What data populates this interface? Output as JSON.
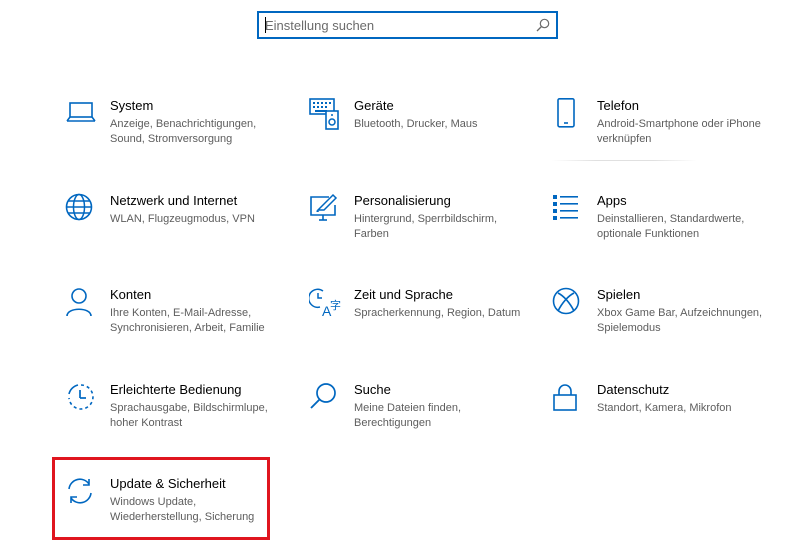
{
  "search": {
    "placeholder": "Einstellung suchen"
  },
  "accent": "#0067c0",
  "highlight_color": "#e0151f",
  "tiles": [
    {
      "icon": "laptop-icon",
      "title": "System",
      "desc": "Anzeige, Benachrichtigungen, Sound, Stromversorgung"
    },
    {
      "icon": "keyboard-devices-icon",
      "title": "Geräte",
      "desc": "Bluetooth, Drucker, Maus"
    },
    {
      "icon": "phone-icon",
      "title": "Telefon",
      "desc": "Android-Smartphone oder iPhone verknüpfen"
    },
    {
      "icon": "globe-icon",
      "title": "Netzwerk und Internet",
      "desc": "WLAN, Flugzeugmodus, VPN"
    },
    {
      "icon": "personalization-icon",
      "title": "Personalisierung",
      "desc": "Hintergrund, Sperrbildschirm, Farben"
    },
    {
      "icon": "apps-list-icon",
      "title": "Apps",
      "desc": "Deinstallieren, Standardwerte, optionale Funktionen"
    },
    {
      "icon": "person-icon",
      "title": "Konten",
      "desc": "Ihre Konten, E-Mail-Adresse, Synchronisieren, Arbeit, Familie"
    },
    {
      "icon": "time-language-icon",
      "title": "Zeit und Sprache",
      "desc": "Spracherkennung, Region, Datum"
    },
    {
      "icon": "xbox-icon",
      "title": "Spielen",
      "desc": "Xbox Game Bar, Aufzeichnungen, Spielemodus"
    },
    {
      "icon": "accessibility-icon",
      "title": "Erleichterte Bedienung",
      "desc": "Sprachausgabe, Bildschirmlupe, hoher Kontrast"
    },
    {
      "icon": "search-icon",
      "title": "Suche",
      "desc": "Meine Dateien finden, Berechtigungen"
    },
    {
      "icon": "lock-icon",
      "title": "Datenschutz",
      "desc": "Standort, Kamera, Mikrofon"
    },
    {
      "icon": "sync-icon",
      "title": "Update & Sicherheit",
      "desc": "Windows Update, Wiederherstellung, Sicherung"
    }
  ]
}
